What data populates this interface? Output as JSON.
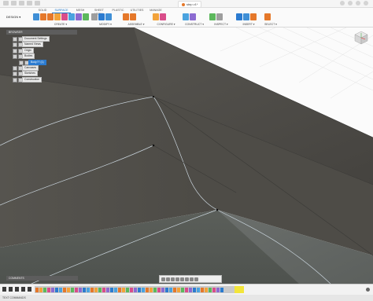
{
  "window": {
    "document_title": "step v1*"
  },
  "toolbar": {
    "workspace": "DESIGN ▾",
    "tabs": [
      "SOLID",
      "SURFACE",
      "MESH",
      "SHEET METAL",
      "PLASTIC",
      "UTILITIES",
      "MANAGE"
    ],
    "active_tab": "SURFACE",
    "groups": [
      {
        "label": "CREATE ▾",
        "icons": [
          "sketch-icon",
          "extrude-icon",
          "revolve-icon",
          "sweep-icon",
          "loft-icon",
          "patch-icon",
          "offset-icon",
          "ruled-icon"
        ]
      },
      {
        "label": "MODIFY ▾",
        "icons": [
          "trim-icon",
          "untrim-icon",
          "extend-icon"
        ]
      },
      {
        "label": "ASSEMBLE ▾",
        "icons": [
          "joint-icon",
          "component-icon"
        ]
      },
      {
        "label": "CONFIGURE ▾",
        "icons": [
          "table-icon",
          "parameter-icon"
        ]
      },
      {
        "label": "CONSTRUCT ▾",
        "icons": [
          "plane-icon",
          "axis-icon"
        ]
      },
      {
        "label": "INSPECT ▾",
        "icons": [
          "measure-icon",
          "section-icon"
        ]
      },
      {
        "label": "INSERT ▾",
        "icons": [
          "insert-icon",
          "canvas-icon",
          "decal-icon"
        ]
      },
      {
        "label": "SELECT ▾",
        "icons": [
          "select-icon"
        ]
      }
    ]
  },
  "browser": {
    "header": "BROWSER",
    "items": [
      {
        "label": "Document Settings"
      },
      {
        "label": "Named Views"
      },
      {
        "label": "Origin"
      },
      {
        "label": "Bodies"
      },
      {
        "label": "Body?? (1)"
      },
      {
        "label": "Canvases"
      },
      {
        "label": "Sketches"
      },
      {
        "label": "Construction"
      }
    ]
  },
  "comments": {
    "header": "COMMENTS"
  },
  "statusbar": {
    "text": "TEXT COMMANDS"
  },
  "colors": {
    "accent": "#2b7bd0",
    "model": "#4f4d48",
    "marker": "#f3e53a"
  }
}
